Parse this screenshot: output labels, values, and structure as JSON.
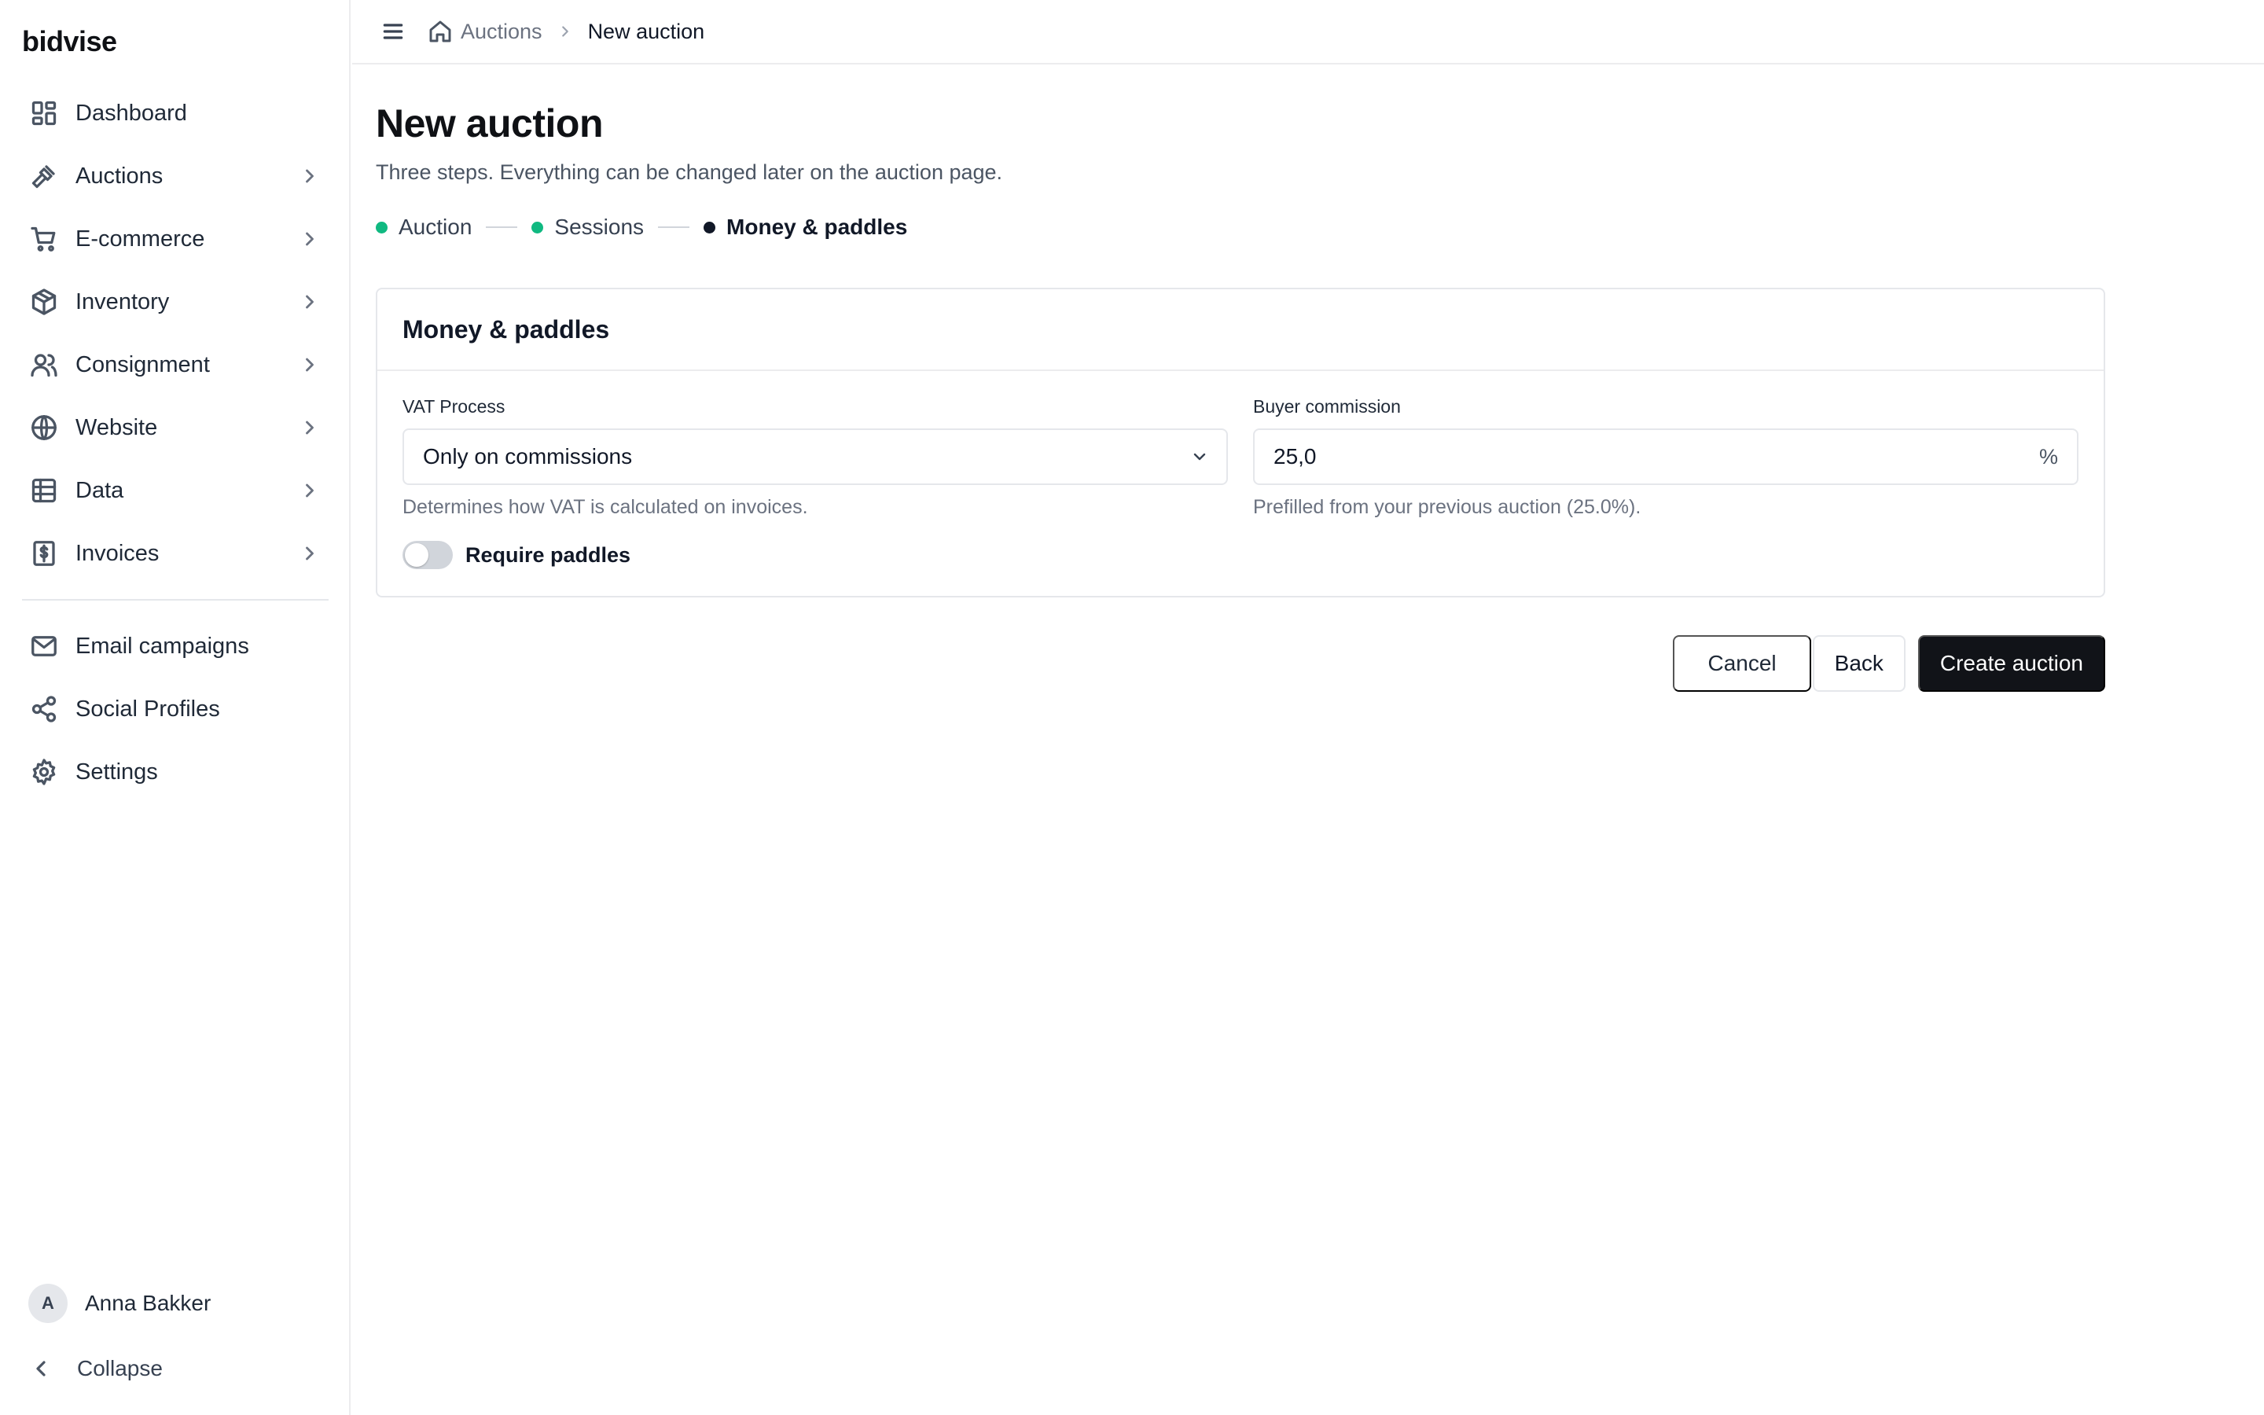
{
  "brand": "bidvise",
  "colors": {
    "accent": "#111318",
    "step_done": "#10b981",
    "step_current": "#111827",
    "toggle_off": "#d1d5db"
  },
  "sidebar": {
    "items": [
      {
        "label": "Dashboard",
        "icon": "dashboard-icon",
        "has_chevron": false
      },
      {
        "label": "Auctions",
        "icon": "gavel-icon",
        "has_chevron": true
      },
      {
        "label": "E-commerce",
        "icon": "cart-icon",
        "has_chevron": true
      },
      {
        "label": "Inventory",
        "icon": "box-icon",
        "has_chevron": true
      },
      {
        "label": "Consignment",
        "icon": "users-icon",
        "has_chevron": true
      },
      {
        "label": "Website",
        "icon": "globe-icon",
        "has_chevron": true
      },
      {
        "label": "Data",
        "icon": "table-icon",
        "has_chevron": true
      },
      {
        "label": "Invoices",
        "icon": "invoice-icon",
        "has_chevron": true
      }
    ],
    "secondary": [
      {
        "label": "Email campaigns",
        "icon": "mail-icon"
      },
      {
        "label": "Social Profiles",
        "icon": "share-icon"
      },
      {
        "label": "Settings",
        "icon": "gear-icon"
      }
    ],
    "user": {
      "initial": "A",
      "name": "Anna Bakker"
    },
    "collapse_label": "Collapse"
  },
  "breadcrumb": {
    "parent": "Auctions",
    "current": "New auction"
  },
  "page": {
    "title": "New auction",
    "subtitle": "Three steps. Everything can be changed later on the auction page."
  },
  "steps": [
    {
      "label": "Auction",
      "state": "done"
    },
    {
      "label": "Sessions",
      "state": "done"
    },
    {
      "label": "Money & paddles",
      "state": "current"
    }
  ],
  "card": {
    "title": "Money & paddles",
    "vat": {
      "label": "VAT Process",
      "value": "Only on commissions",
      "hint": "Determines how VAT is calculated on invoices."
    },
    "commission": {
      "label": "Buyer commission",
      "value": "25,0",
      "suffix": "%",
      "hint": "Prefilled from your previous auction (25.0%)."
    },
    "paddles": {
      "label": "Require paddles",
      "enabled": false
    }
  },
  "actions": {
    "cancel": "Cancel",
    "back": "Back",
    "create": "Create auction"
  }
}
